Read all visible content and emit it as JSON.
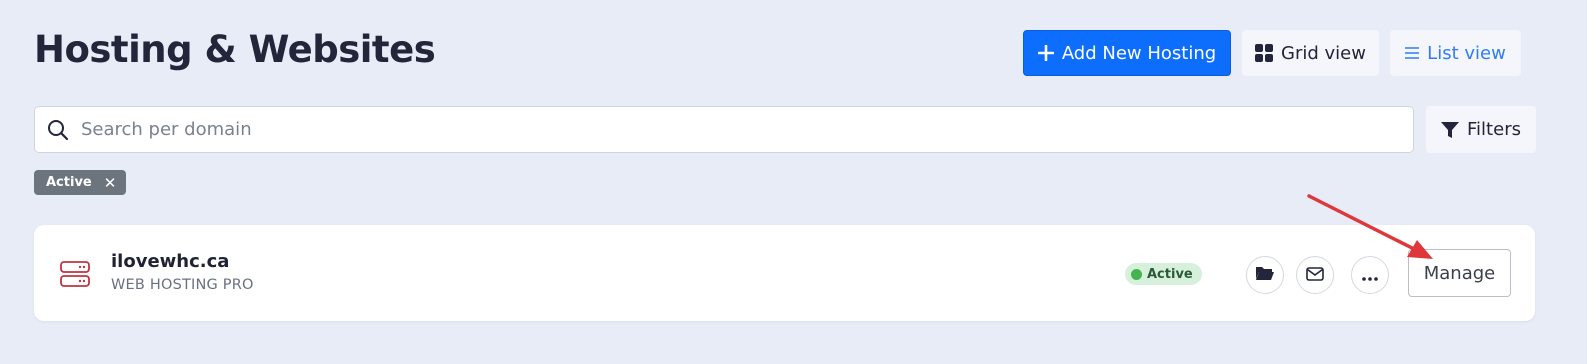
{
  "header": {
    "title": "Hosting & Websites",
    "add_button": {
      "label": "Add New Hosting",
      "icon": "plus-icon"
    },
    "grid_view_button": {
      "label": "Grid view",
      "icon": "grid-icon"
    },
    "list_view_button": {
      "label": "List view",
      "icon": "list-icon"
    }
  },
  "search": {
    "placeholder": "Search per domain",
    "value": "",
    "icon": "search-icon"
  },
  "filters_button": {
    "label": "Filters",
    "icon": "filter-icon"
  },
  "active_filters": [
    {
      "label": "Active",
      "remove_label": "✕"
    }
  ],
  "hosting_list": [
    {
      "domain": "ilovewhc.ca",
      "plan": "WEB HOSTING PRO",
      "status": "Active",
      "icon": "server-icon",
      "actions": [
        "folder-icon",
        "mail-icon",
        "more-icon"
      ],
      "manage_label": "Manage"
    }
  ],
  "colors": {
    "primary": "#0d6efd",
    "list_view_accent": "#2f7df6",
    "status_bg": "#d7f0dc",
    "status_dot": "#45b34f",
    "server_icon": "#c0343e",
    "annotation_arrow": "#e0373b"
  }
}
